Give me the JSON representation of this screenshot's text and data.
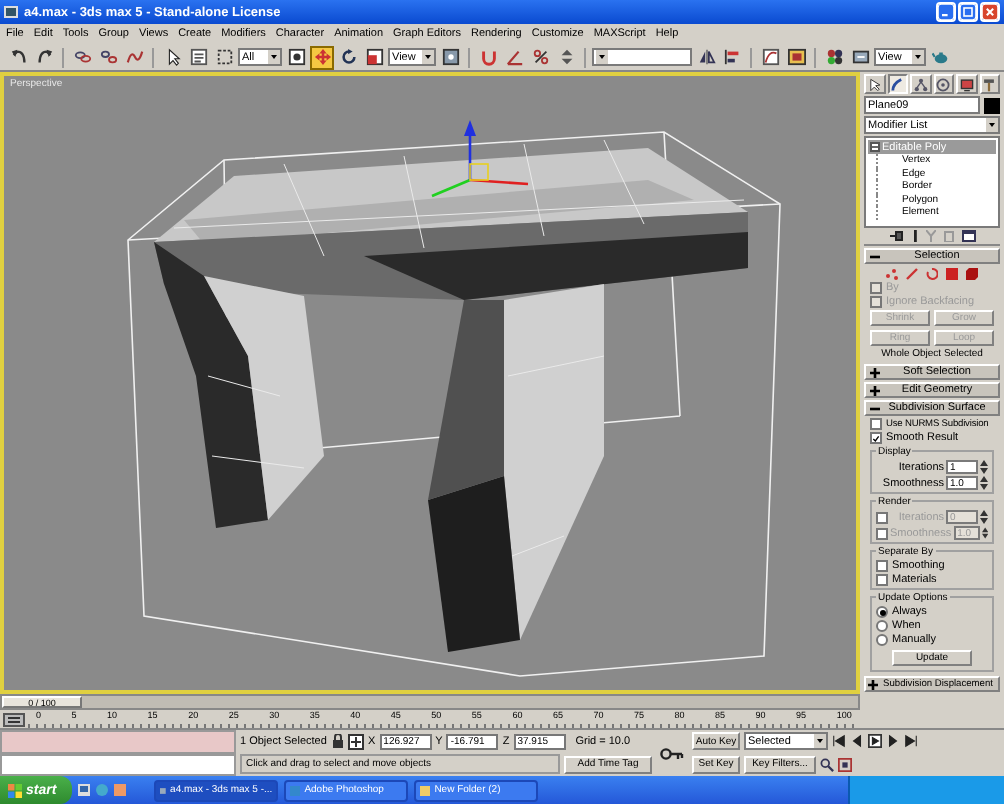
{
  "window": {
    "title": "a4.max - 3ds max 5 - Stand-alone License"
  },
  "menu": [
    "File",
    "Edit",
    "Tools",
    "Group",
    "Views",
    "Create",
    "Modifiers",
    "Character",
    "Animation",
    "Graph Editors",
    "Rendering",
    "Customize",
    "MAXScript",
    "Help"
  ],
  "toolbar": {
    "tools": [
      {
        "selected": false
      },
      {
        "selected": false
      },
      {
        "selected": false
      },
      {
        "selected": false
      },
      {
        "selected": false
      },
      {
        "selected": false
      },
      {
        "selected": false
      },
      {
        "selected": false
      },
      {
        "selected": false
      },
      {
        "selected": true
      },
      {
        "selected": false
      },
      {
        "selected": false
      },
      {
        "selected": false
      },
      {
        "selected": false
      },
      {
        "selected": false
      },
      {
        "selected": false
      },
      {
        "selected": false
      },
      {
        "selected": false
      },
      {
        "selected": false
      },
      {
        "selected": false
      },
      {
        "selected": false
      },
      {
        "selected": false
      },
      {
        "selected": false
      },
      {
        "selected": false
      }
    ],
    "selection_filter": "All",
    "coordinate_system": "View",
    "render_mode": "View"
  },
  "viewport": {
    "label": "Perspective",
    "active": true
  },
  "command_panel": {
    "tabs": [
      {
        "selected": false
      },
      {
        "selected": true
      },
      {
        "selected": false
      },
      {
        "selected": false
      },
      {
        "selected": false
      },
      {
        "selected": false
      }
    ],
    "object_name": "Plane09",
    "modifier_list": "Modifier List",
    "stack": [
      {
        "label": "Editable Poly",
        "selected": true,
        "expanded": true,
        "children": [
          {
            "label": "Vertex",
            "selected": false
          },
          {
            "label": "Edge",
            "selected": false
          },
          {
            "label": "Border",
            "selected": false
          },
          {
            "label": "Polygon",
            "selected": false
          },
          {
            "label": "Element",
            "selected": false
          }
        ]
      }
    ],
    "selection": {
      "title": "Selection",
      "expanded": true,
      "by": {
        "label": "By",
        "checked": false,
        "disabled": true
      },
      "ignore_backfacing": {
        "label": "Ignore Backfacing",
        "checked": false,
        "disabled": true
      },
      "buttons": [
        {
          "label": "Shrink",
          "disabled": true
        },
        {
          "label": "Grow",
          "disabled": true
        },
        {
          "label": "Ring",
          "disabled": true
        },
        {
          "label": "Loop",
          "disabled": true
        }
      ],
      "info": "Whole Object Selected"
    },
    "rollouts": [
      {
        "title": "Soft Selection",
        "expanded": false
      },
      {
        "title": "Edit Geometry",
        "expanded": false
      }
    ],
    "subdivision": {
      "title": "Subdivision Surface",
      "expanded": true,
      "use_nurms": {
        "label": "Use NURMS Subdivision",
        "checked": false
      },
      "smooth_result": {
        "label": "Smooth Result",
        "checked": true
      },
      "display": {
        "title": "Display",
        "iterations": {
          "label": "Iterations",
          "value": "1"
        },
        "smoothness": {
          "label": "Smoothness",
          "value": "1.0"
        }
      },
      "render": {
        "title": "Render",
        "iterations": {
          "label": "Iterations",
          "value": "0",
          "checked": false
        },
        "smoothness": {
          "label": "Smoothness",
          "value": "1.0",
          "checked": false
        }
      },
      "separate_by": {
        "title": "Separate By",
        "options": [
          {
            "label": "Smoothing",
            "checked": false
          },
          {
            "label": "Materials",
            "checked": false
          }
        ]
      },
      "update_options": {
        "title": "Update Options",
        "options": [
          {
            "label": "Always",
            "selected": true
          },
          {
            "label": "When",
            "selected": false
          },
          {
            "label": "Manually",
            "selected": false
          }
        ],
        "button": "Update"
      }
    },
    "displacement": {
      "title": "Subdivision Displacement",
      "expanded": false
    }
  },
  "time_slider": {
    "label": "0 / 100",
    "level": 0
  },
  "track_bar": {
    "ticks": [
      "0",
      "5",
      "10",
      "15",
      "20",
      "25",
      "30",
      "35",
      "40",
      "45",
      "50",
      "55",
      "60",
      "65",
      "70",
      "75",
      "80",
      "85",
      "90",
      "95",
      "100"
    ]
  },
  "status": {
    "selection_info": "1 Object Selected",
    "coords": [
      {
        "axis": "X",
        "value": "126.927"
      },
      {
        "axis": "Y",
        "value": "-16.791"
      },
      {
        "axis": "Z",
        "value": "37.915"
      }
    ],
    "grid": "Grid = 10.0",
    "prompt": "Click and drag to select and move objects",
    "add_time_tag": "Add Time Tag",
    "auto_key": "Auto Key",
    "key_mode": "Selected",
    "set_key": "Set Key",
    "key_filters": "Key Filters..."
  },
  "taskbar": {
    "start": "start",
    "tasks": [
      {
        "label": "a4.max - 3ds max 5 -...",
        "selected": true
      },
      {
        "label": "Adobe Photoshop",
        "selected": false
      },
      {
        "label": "New Folder (2)",
        "selected": false
      }
    ]
  }
}
